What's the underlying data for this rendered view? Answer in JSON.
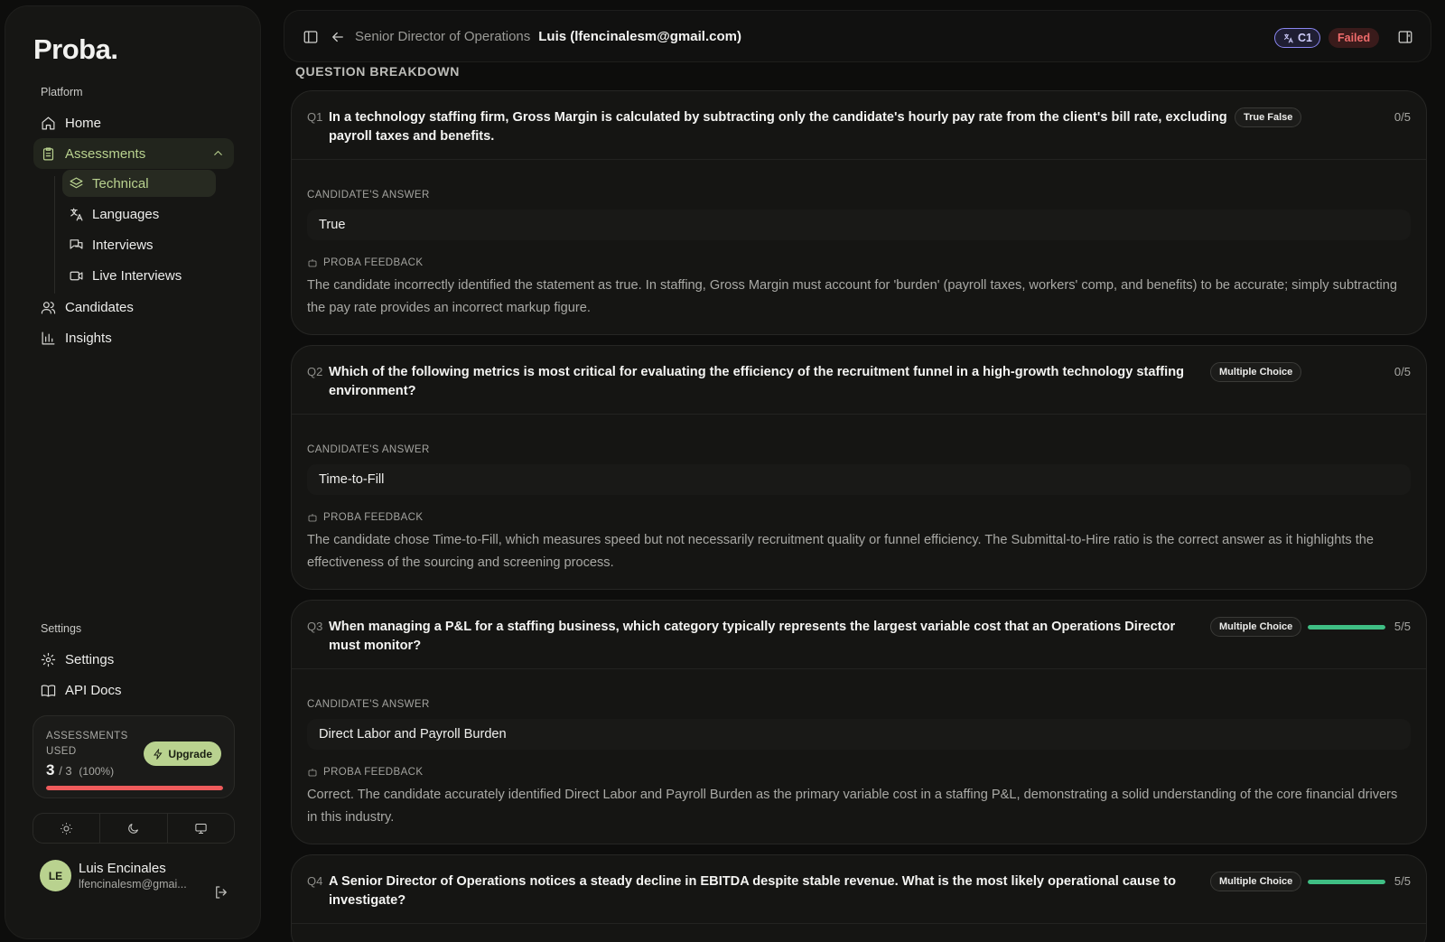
{
  "app": {
    "logo": "Proba."
  },
  "sidebar": {
    "platform_label": "Platform",
    "settings_label": "Settings",
    "nav": {
      "home": "Home",
      "assessments": "Assessments",
      "technical": "Technical",
      "languages": "Languages",
      "interviews": "Interviews",
      "live_interviews": "Live Interviews",
      "candidates": "Candidates",
      "insights": "Insights",
      "settings": "Settings",
      "api_docs": "API Docs"
    },
    "usage": {
      "label": "ASSESSMENTS USED",
      "used": "3",
      "total": "/ 3",
      "percent": "(100%)",
      "fraction": 1.0,
      "upgrade_label": "Upgrade"
    },
    "user": {
      "initials": "LE",
      "name": "Luis Encinales",
      "email": "lfencinalesm@gmai..."
    }
  },
  "header": {
    "breadcrumb_parent": "Senior Director of Operations",
    "breadcrumb_current": "Luis (lfencinalesm@gmail.com)",
    "level": "C1",
    "status": "Failed"
  },
  "colors": {
    "accent": "#b9d28f",
    "failed": "#ef6b6b",
    "level": "#8a86f0",
    "score_bar": "#3fbe84",
    "usage_bar": "#ef5b5b"
  },
  "main": {
    "section_title": "QUESTION BREAKDOWN",
    "answer_label": "CANDIDATE'S ANSWER",
    "feedback_label": "PROBA FEEDBACK",
    "questions": [
      {
        "num": "Q1",
        "text": "In a technology staffing firm, Gross Margin is calculated by subtracting only the candidate's hourly pay rate from the client's bill rate, excluding payroll taxes and benefits.",
        "type": "True False",
        "score": "0/5",
        "score_fraction": 0,
        "answer": "True",
        "feedback": "The candidate incorrectly identified the statement as true. In staffing, Gross Margin must account for 'burden' (payroll taxes, workers' comp, and benefits) to be accurate; simply subtracting the pay rate provides an incorrect markup figure."
      },
      {
        "num": "Q2",
        "text": "Which of the following metrics is most critical for evaluating the efficiency of the recruitment funnel in a high-growth technology staffing environment?",
        "type": "Multiple Choice",
        "score": "0/5",
        "score_fraction": 0,
        "answer": "Time-to-Fill",
        "feedback": "The candidate chose Time-to-Fill, which measures speed but not necessarily recruitment quality or funnel efficiency. The Submittal-to-Hire ratio is the correct answer as it highlights the effectiveness of the sourcing and screening process."
      },
      {
        "num": "Q3",
        "text": "When managing a P&L for a staffing business, which category typically represents the largest variable cost that an Operations Director must monitor?",
        "type": "Multiple Choice",
        "score": "5/5",
        "score_fraction": 1,
        "answer": "Direct Labor and Payroll Burden",
        "feedback": "Correct. The candidate accurately identified Direct Labor and Payroll Burden as the primary variable cost in a staffing P&L, demonstrating a solid understanding of the core financial drivers in this industry."
      },
      {
        "num": "Q4",
        "text": "A Senior Director of Operations notices a steady decline in EBITDA despite stable revenue. What is the most likely operational cause to investigate?",
        "type": "Multiple Choice",
        "score": "5/5",
        "score_fraction": 1
      }
    ]
  }
}
